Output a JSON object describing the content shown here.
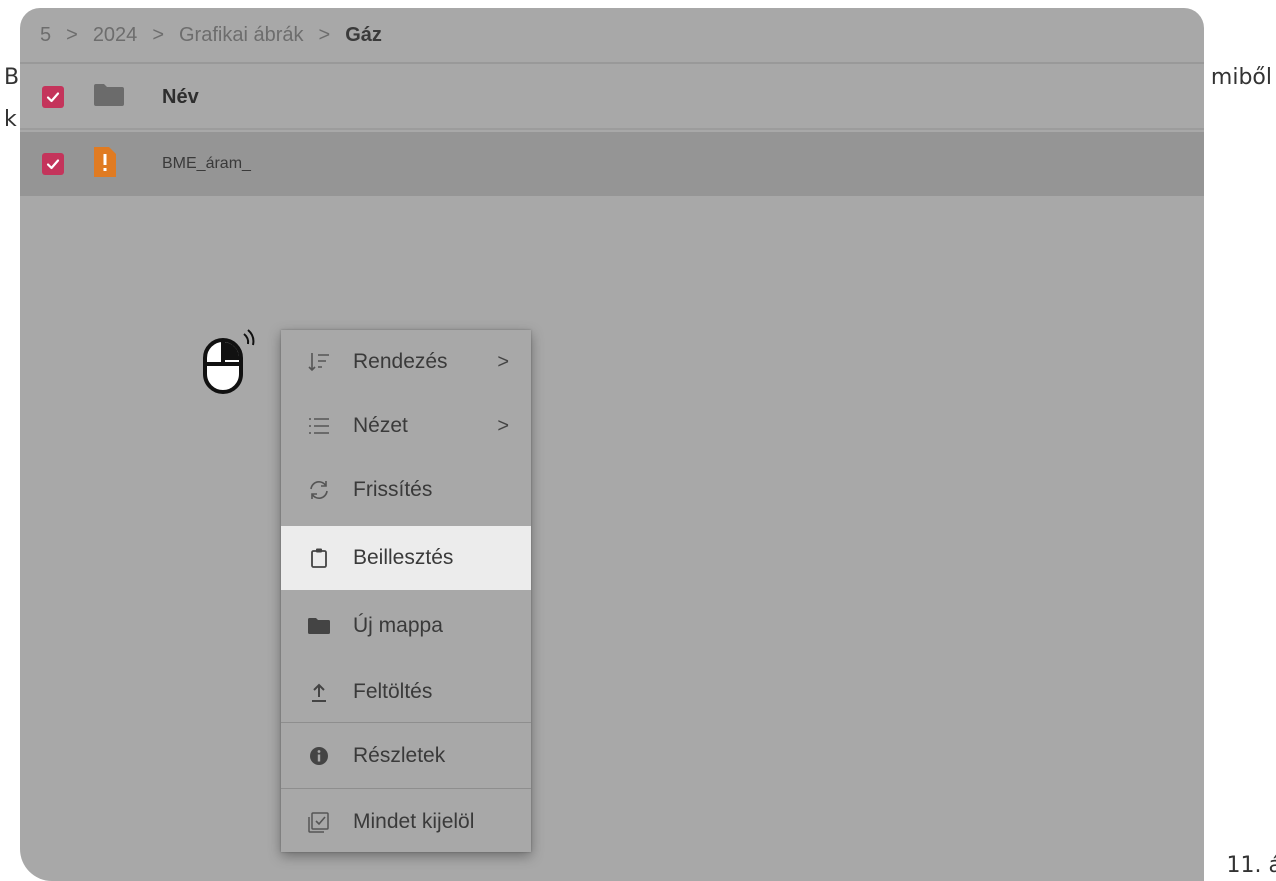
{
  "document": {
    "left_fragment_1": "B",
    "left_fragment_2": "k",
    "right_fragment": "miből",
    "caption_fragment": "11. á"
  },
  "breadcrumb": {
    "items": [
      "5",
      "2024",
      "Grafikai ábrák"
    ],
    "current": "Gáz",
    "separator": ">"
  },
  "file_list": {
    "header": {
      "name_label": "Név",
      "checked": true
    },
    "rows": [
      {
        "name": "BME_áram_",
        "checked": true,
        "icon": "warning-file-icon"
      }
    ]
  },
  "context_menu": {
    "items": [
      {
        "label": "Rendezés",
        "icon": "sort-icon",
        "submenu": true,
        "arrow": ">"
      },
      {
        "label": "Nézet",
        "icon": "list-view-icon",
        "submenu": true,
        "arrow": ">"
      },
      {
        "label": "Frissítés",
        "icon": "refresh-icon",
        "submenu": false
      },
      {
        "label": "Beillesztés",
        "icon": "clipboard-icon",
        "submenu": false,
        "highlighted": true
      },
      {
        "label": "Új mappa",
        "icon": "folder-icon",
        "submenu": false
      },
      {
        "label": "Feltöltés",
        "icon": "upload-icon",
        "submenu": false
      },
      {
        "label": "Részletek",
        "icon": "info-icon",
        "submenu": false
      },
      {
        "label": "Mindet kijelöl",
        "icon": "select-all-icon",
        "submenu": false
      }
    ]
  },
  "colors": {
    "overlay": "#a8a8a8",
    "selected_row": "#959595",
    "checkbox": "#c4345b",
    "warning_file": "#e07b22",
    "highlight": "#ececec"
  }
}
